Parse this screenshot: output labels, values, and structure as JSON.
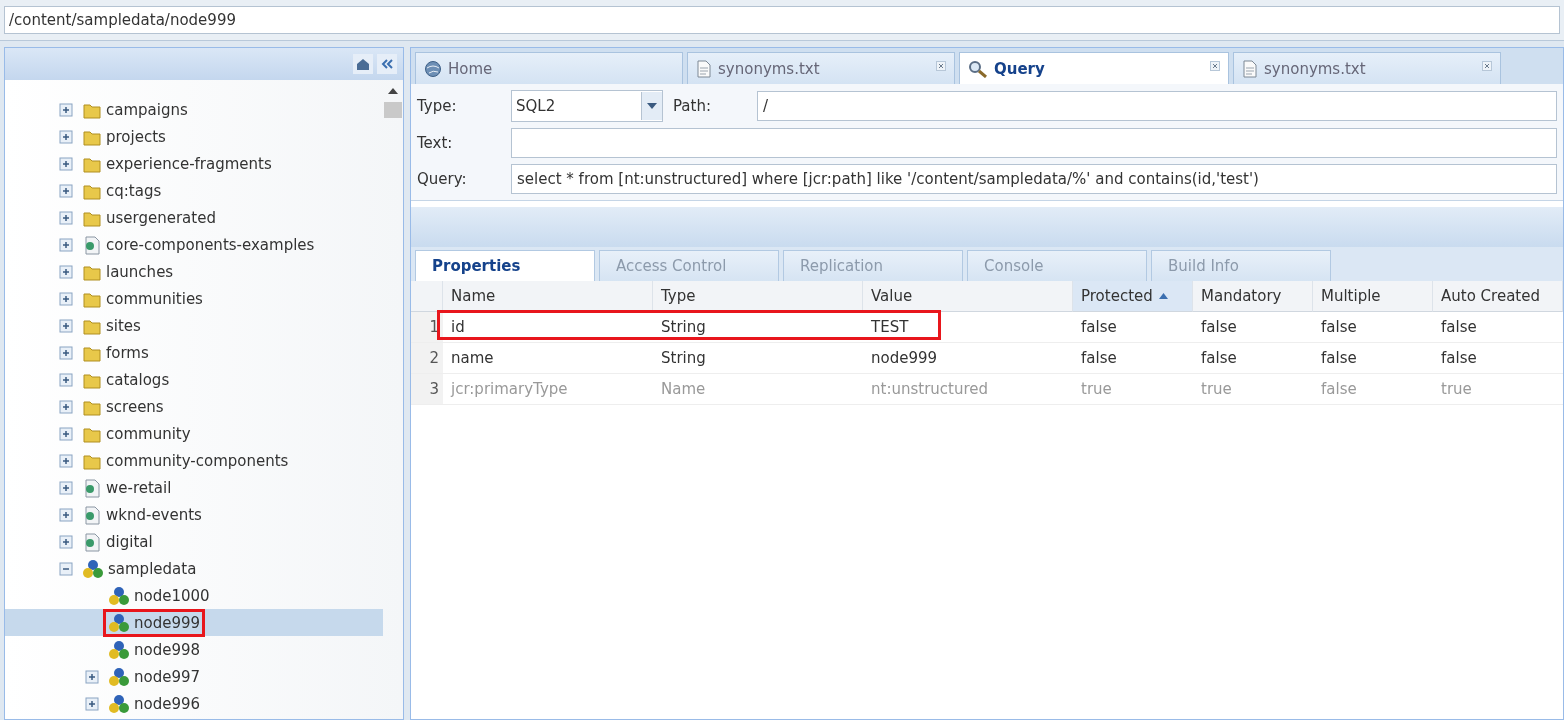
{
  "path_bar": {
    "value": "/content/sampledata/node999"
  },
  "tree": [
    {
      "label": "campaigns",
      "kind": "folder",
      "expandable": true,
      "expanded": false,
      "selected": false,
      "annotated": false
    },
    {
      "label": "projects",
      "kind": "folder",
      "expandable": true,
      "expanded": false,
      "selected": false,
      "annotated": false
    },
    {
      "label": "experience-fragments",
      "kind": "folder",
      "expandable": true,
      "expanded": false,
      "selected": false,
      "annotated": false
    },
    {
      "label": "cq:tags",
      "kind": "folder",
      "expandable": true,
      "expanded": false,
      "selected": false,
      "annotated": false
    },
    {
      "label": "usergenerated",
      "kind": "folder",
      "expandable": true,
      "expanded": false,
      "selected": false,
      "annotated": false
    },
    {
      "label": "core-components-examples",
      "kind": "page",
      "expandable": true,
      "expanded": false,
      "selected": false,
      "annotated": false
    },
    {
      "label": "launches",
      "kind": "folder",
      "expandable": true,
      "expanded": false,
      "selected": false,
      "annotated": false
    },
    {
      "label": "communities",
      "kind": "folder",
      "expandable": true,
      "expanded": false,
      "selected": false,
      "annotated": false
    },
    {
      "label": "sites",
      "kind": "folder",
      "expandable": true,
      "expanded": false,
      "selected": false,
      "annotated": false
    },
    {
      "label": "forms",
      "kind": "folder",
      "expandable": true,
      "expanded": false,
      "selected": false,
      "annotated": false
    },
    {
      "label": "catalogs",
      "kind": "folder",
      "expandable": true,
      "expanded": false,
      "selected": false,
      "annotated": false
    },
    {
      "label": "screens",
      "kind": "folder",
      "expandable": true,
      "expanded": false,
      "selected": false,
      "annotated": false
    },
    {
      "label": "community",
      "kind": "folder",
      "expandable": true,
      "expanded": false,
      "selected": false,
      "annotated": false
    },
    {
      "label": "community-components",
      "kind": "folder",
      "expandable": true,
      "expanded": false,
      "selected": false,
      "annotated": false
    },
    {
      "label": "we-retail",
      "kind": "page",
      "expandable": true,
      "expanded": false,
      "selected": false,
      "annotated": false
    },
    {
      "label": "wknd-events",
      "kind": "page",
      "expandable": true,
      "expanded": false,
      "selected": false,
      "annotated": false
    },
    {
      "label": "digital",
      "kind": "page",
      "expandable": true,
      "expanded": false,
      "selected": false,
      "annotated": false
    },
    {
      "label": "sampledata",
      "kind": "node",
      "expandable": true,
      "expanded": true,
      "selected": false,
      "annotated": false,
      "children": [
        {
          "label": "node1000",
          "kind": "node",
          "expandable": false,
          "selected": false,
          "annotated": false
        },
        {
          "label": "node999",
          "kind": "node",
          "expandable": false,
          "selected": true,
          "annotated": true
        },
        {
          "label": "node998",
          "kind": "node",
          "expandable": false,
          "selected": false,
          "annotated": false
        },
        {
          "label": "node997",
          "kind": "node",
          "expandable": true,
          "expanded": false,
          "selected": false,
          "annotated": false
        },
        {
          "label": "node996",
          "kind": "node",
          "expandable": true,
          "expanded": false,
          "selected": false,
          "annotated": false
        }
      ]
    }
  ],
  "tabs": [
    {
      "label": "Home",
      "kind": "home",
      "selected": false,
      "closable": false
    },
    {
      "label": "synonyms.txt",
      "kind": "file",
      "selected": false,
      "closable": true
    },
    {
      "label": "Query",
      "kind": "search",
      "selected": true,
      "closable": true
    },
    {
      "label": "synonyms.txt",
      "kind": "file",
      "selected": false,
      "closable": true
    }
  ],
  "query_form": {
    "type_label": "Type:",
    "type_value": "SQL2",
    "path_label": "Path:",
    "path_value": "/",
    "text_label": "Text:",
    "query_label": "Query:",
    "query_value": "select * from [nt:unstructured] where [jcr:path] like '/content/sampledata/%' and contains(id,'test')"
  },
  "subtabs": [
    {
      "label": "Properties",
      "selected": true
    },
    {
      "label": "Access Control",
      "selected": false
    },
    {
      "label": "Replication",
      "selected": false
    },
    {
      "label": "Console",
      "selected": false
    },
    {
      "label": "Build Info",
      "selected": false
    }
  ],
  "table": {
    "columns": [
      {
        "label": "Name",
        "sorted": false
      },
      {
        "label": "Type",
        "sorted": false
      },
      {
        "label": "Value",
        "sorted": false
      },
      {
        "label": "Protected",
        "sorted": true
      },
      {
        "label": "Mandatory",
        "sorted": false
      },
      {
        "label": "Multiple",
        "sorted": false
      },
      {
        "label": "Auto Created",
        "sorted": false
      }
    ],
    "rows": [
      {
        "number": "1",
        "cells": [
          "id",
          "String",
          "TEST",
          "false",
          "false",
          "false",
          "false"
        ],
        "muted": false,
        "annotated": true
      },
      {
        "number": "2",
        "cells": [
          "name",
          "String",
          "node999",
          "false",
          "false",
          "false",
          "false"
        ],
        "muted": false,
        "annotated": false
      },
      {
        "number": "3",
        "cells": [
          "jcr:primaryType",
          "Name",
          "nt:unstructured",
          "true",
          "true",
          "false",
          "true"
        ],
        "muted": true,
        "annotated": false
      }
    ]
  }
}
